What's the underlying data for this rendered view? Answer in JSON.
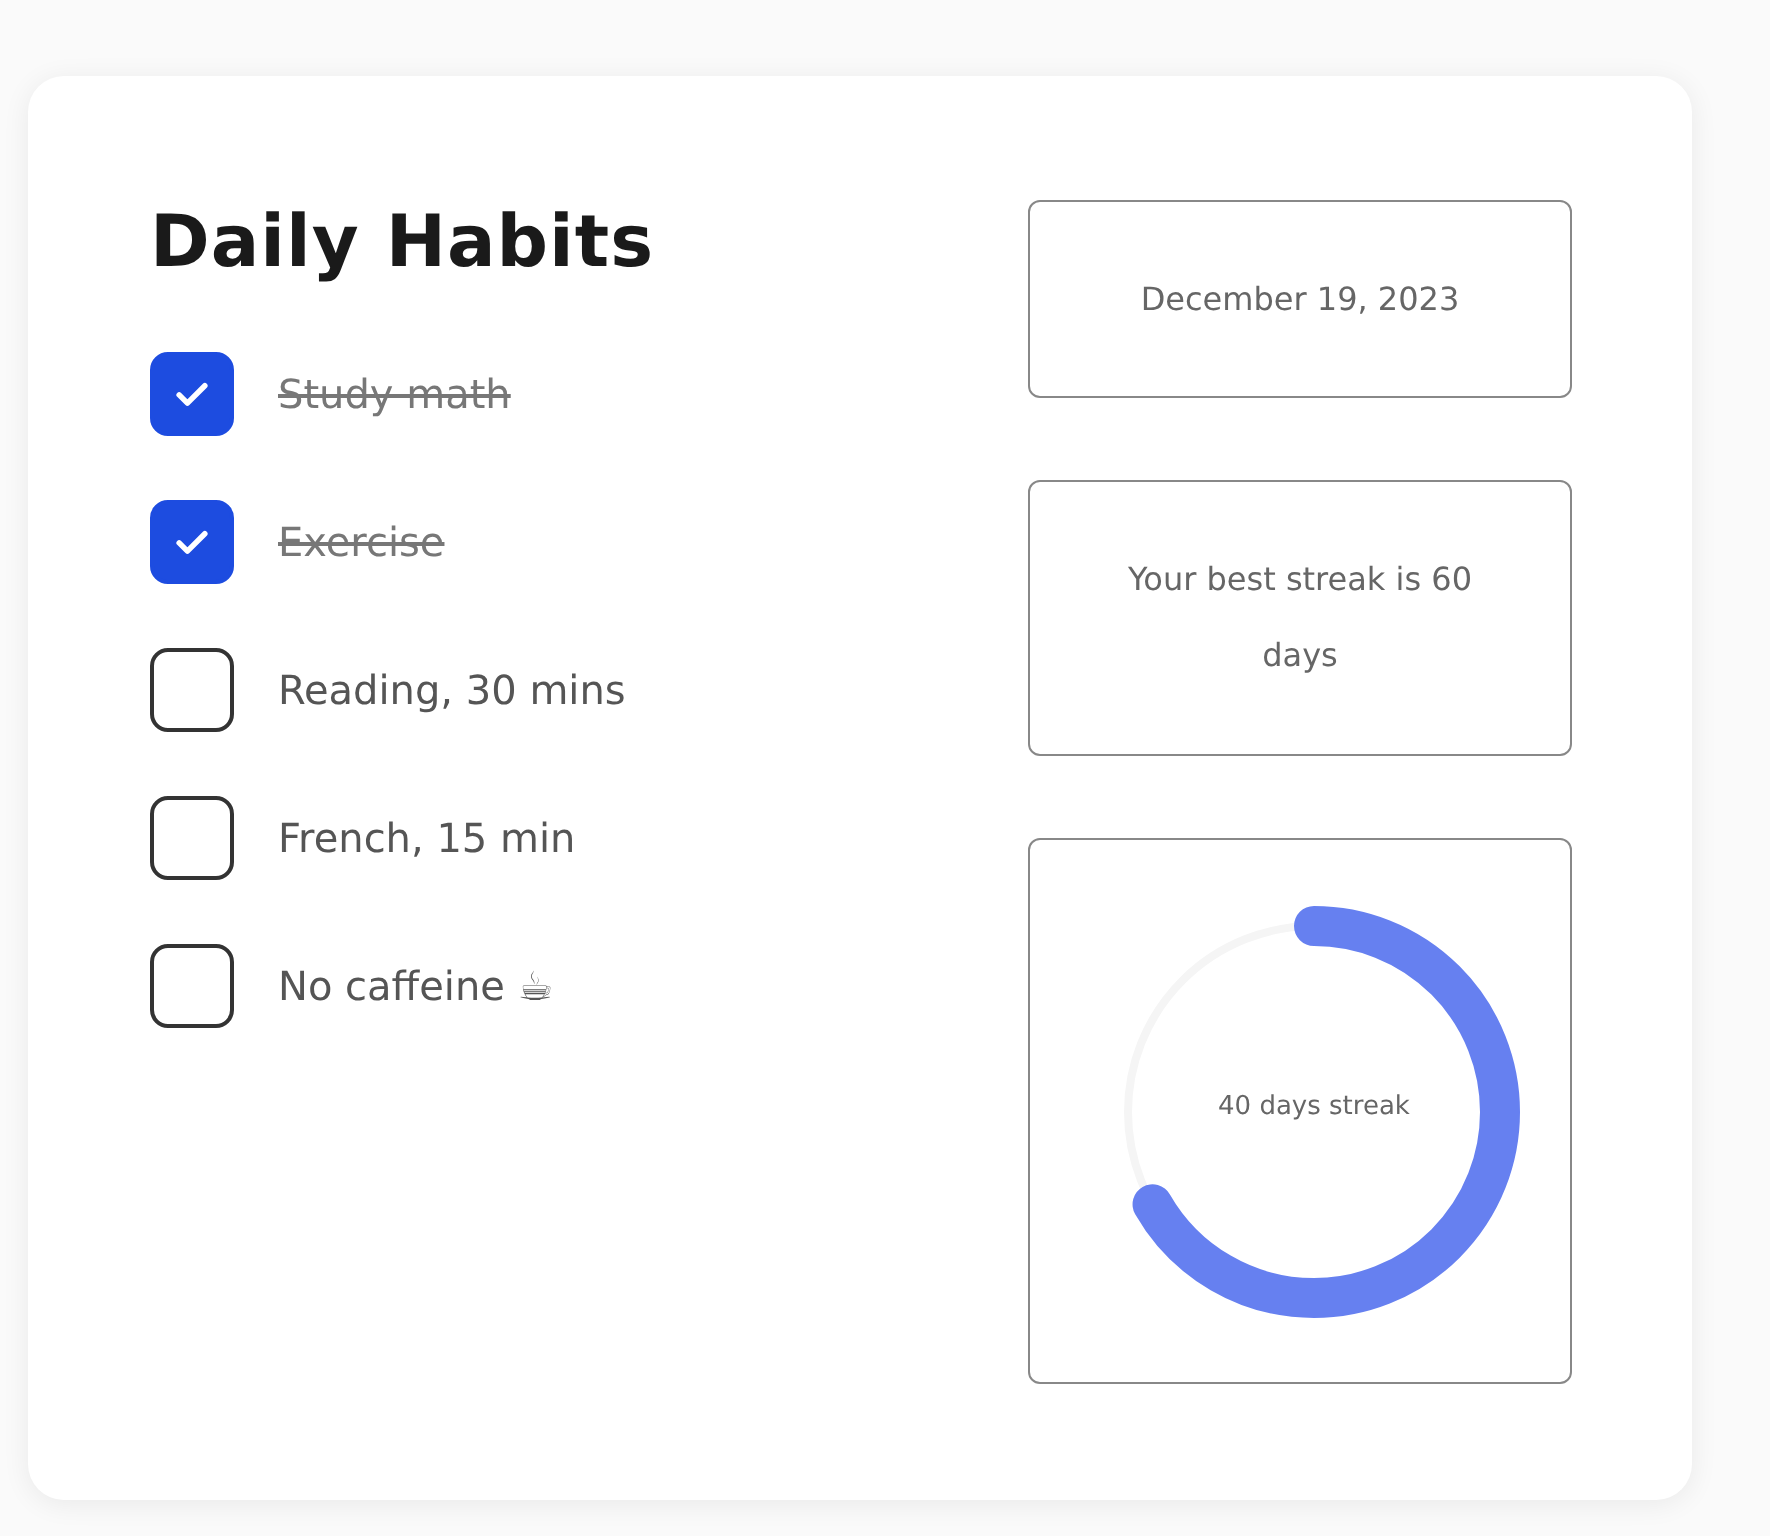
{
  "title": "Daily Habits",
  "habits": [
    {
      "label": "Study math",
      "checked": true
    },
    {
      "label": "Exercise",
      "checked": true
    },
    {
      "label": "Reading, 30 mins",
      "checked": false
    },
    {
      "label": "French, 15 min",
      "checked": false
    },
    {
      "label": "No caffeine ☕",
      "checked": false
    }
  ],
  "date": "December 19, 2023",
  "best_streak": "Your best streak is 60 days",
  "streak": {
    "label": "40 days streak",
    "level": 0.667
  }
}
